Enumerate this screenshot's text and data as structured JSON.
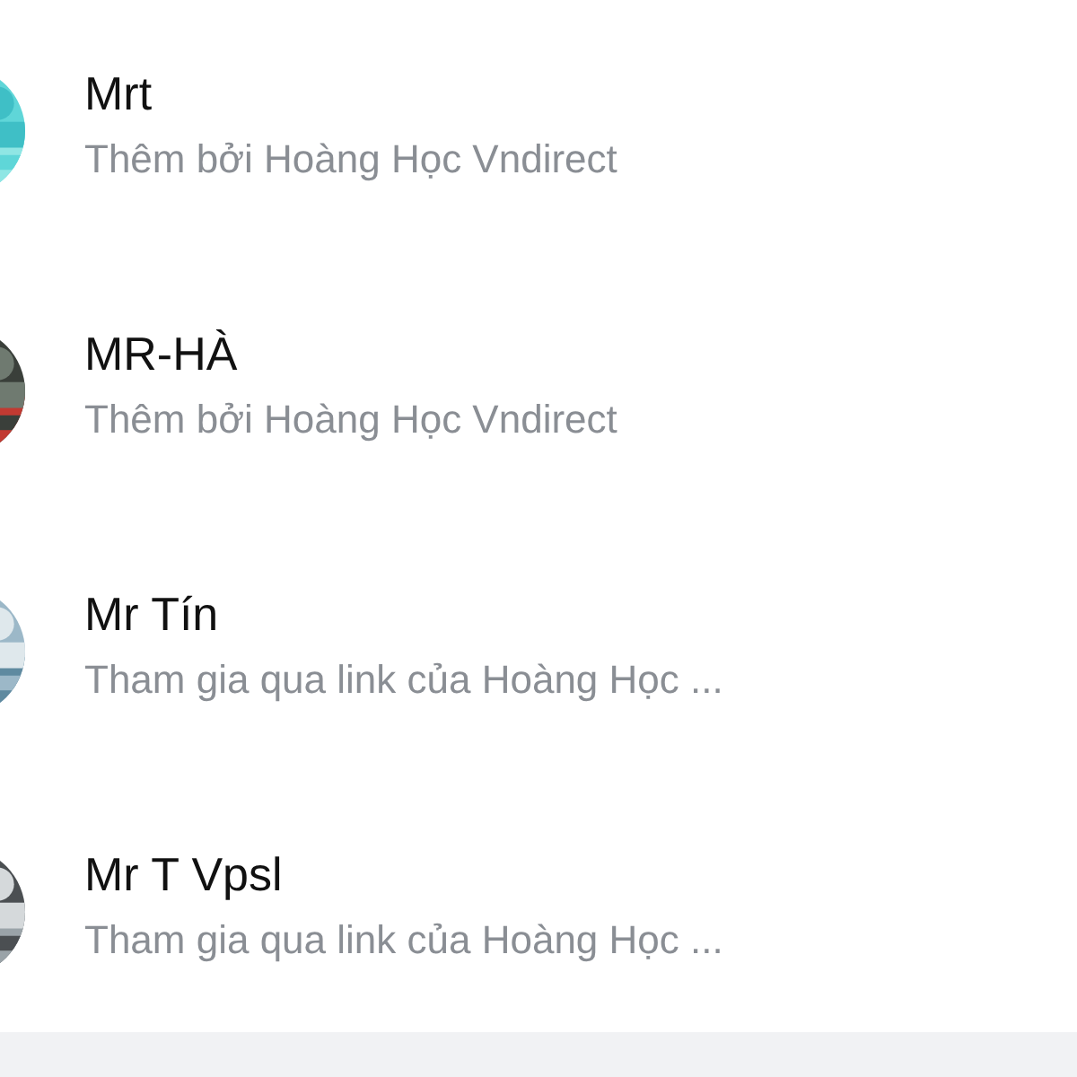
{
  "members": [
    {
      "name": "Mrt",
      "subtitle": "Thêm bởi Hoàng Học Vndirect"
    },
    {
      "name": "MR-HÀ",
      "subtitle": "Thêm bởi Hoàng Học Vndirect"
    },
    {
      "name": "Mr Tín",
      "subtitle": "Tham gia qua link của Hoàng Học ..."
    },
    {
      "name": "Mr T Vpsl",
      "subtitle": "Tham gia qua link của Hoàng Học ..."
    }
  ]
}
